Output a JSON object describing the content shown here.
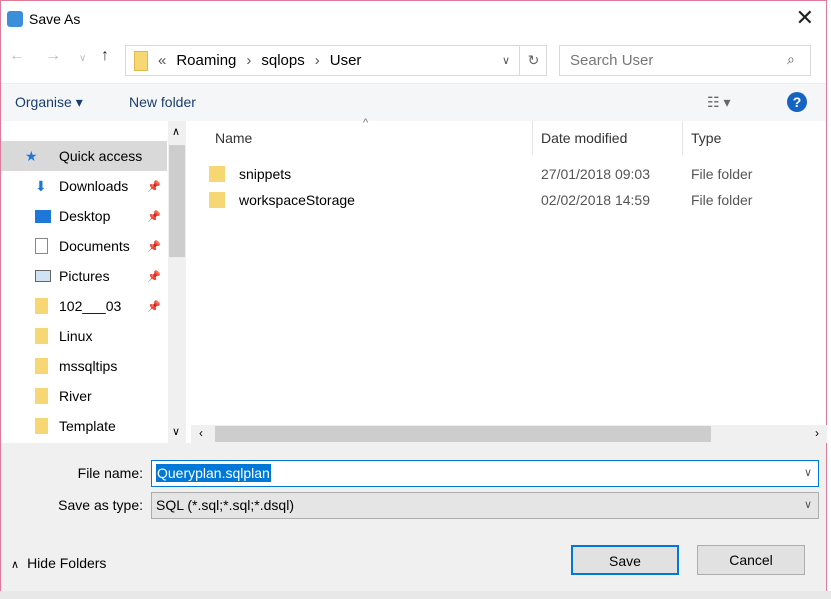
{
  "window": {
    "title": "Save As",
    "close": "✕"
  },
  "address": {
    "crumbs": [
      "«",
      "Roaming",
      "›",
      "sqlops",
      "›",
      "User"
    ],
    "search_placeholder": "Search User"
  },
  "toolbar": {
    "organise": "Organise ▾",
    "new_folder": "New folder",
    "help": "?"
  },
  "nav": [
    {
      "label": "Quick access",
      "icon": "star-icon"
    },
    {
      "label": "Downloads",
      "icon": "download-icon",
      "pinned": true
    },
    {
      "label": "Desktop",
      "icon": "desktop-icon",
      "pinned": true
    },
    {
      "label": "Documents",
      "icon": "documents-icon",
      "pinned": true
    },
    {
      "label": "Pictures",
      "icon": "pictures-icon",
      "pinned": true
    },
    {
      "label": "102___03",
      "icon": "folder-icon",
      "pinned": true
    },
    {
      "label": "Linux",
      "icon": "folder-icon"
    },
    {
      "label": "mssqltips",
      "icon": "folder-icon"
    },
    {
      "label": "River",
      "icon": "folder-icon"
    },
    {
      "label": "Template",
      "icon": "folder-icon"
    }
  ],
  "columns": [
    "Name",
    "Date modified",
    "Type"
  ],
  "files": [
    {
      "name": "snippets",
      "date": "27/01/2018 09:03",
      "type": "File folder"
    },
    {
      "name": "workspaceStorage",
      "date": "02/02/2018 14:59",
      "type": "File folder"
    }
  ],
  "form": {
    "file_name_label": "File name:",
    "file_name": "Queryplan.sqlplan",
    "type_label": "Save as type:",
    "type_value": "SQL (*.sql;*.sql;*.dsql)"
  },
  "buttons": {
    "hide_folders": "Hide Folders",
    "save": "Save",
    "cancel": "Cancel"
  }
}
